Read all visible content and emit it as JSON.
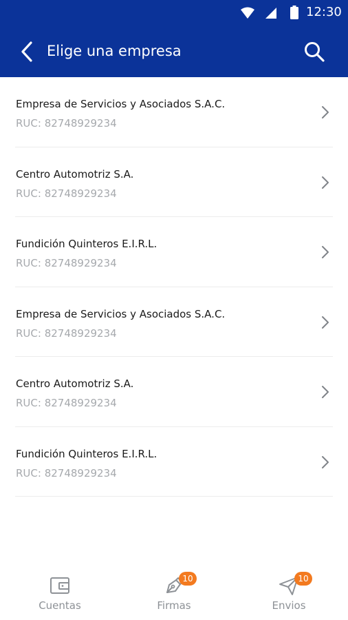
{
  "status_bar": {
    "time": "12:30"
  },
  "toolbar": {
    "title": "Elige una empresa"
  },
  "companies": [
    {
      "name": "Empresa de Servicios y Asociados S.A.C.",
      "ruc": "RUC: 82748929234"
    },
    {
      "name": "Centro Automotriz S.A.",
      "ruc": "RUC: 82748929234"
    },
    {
      "name": "Fundición Quinteros E.I.R.L.",
      "ruc": "RUC: 82748929234"
    },
    {
      "name": "Empresa de Servicios y Asociados S.A.C.",
      "ruc": "RUC: 82748929234"
    },
    {
      "name": "Centro Automotriz S.A.",
      "ruc": "RUC: 82748929234"
    },
    {
      "name": "Fundición Quinteros E.I.R.L.",
      "ruc": "RUC: 82748929234"
    }
  ],
  "bottom_nav": [
    {
      "label": "Cuentas",
      "icon": "wallet-icon",
      "badge": ""
    },
    {
      "label": "Firmas",
      "icon": "pen-icon",
      "badge": "10"
    },
    {
      "label": "Envios",
      "icon": "send-icon",
      "badge": "10"
    }
  ],
  "colors": {
    "primary": "#0b3399",
    "badge": "#f37a1f",
    "muted_text": "#a6a9ad",
    "nav_inactive": "#8d9196"
  }
}
